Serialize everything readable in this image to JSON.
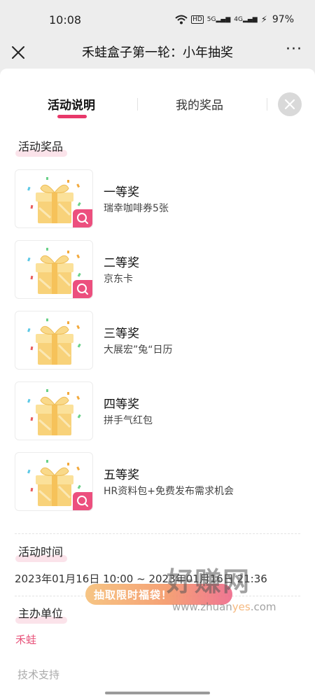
{
  "status_bar": {
    "time": "10:08",
    "hd_badge": "HD",
    "net_5g": "5G",
    "net_4g": "4G",
    "battery": "97%"
  },
  "nav": {
    "title": "禾蛙盒子第一轮：小年抽奖",
    "more": "···"
  },
  "tabs": [
    {
      "label": "活动说明",
      "active": true
    },
    {
      "label": "我的奖品",
      "active": false
    }
  ],
  "sections": {
    "prizes_title": "活动奖品",
    "time_title": "活动时间",
    "organizer_title": "主办单位"
  },
  "prizes": [
    {
      "name": "一等奖",
      "desc": "瑞幸咖啡券5张",
      "has_zoom": true
    },
    {
      "name": "二等奖",
      "desc": "京东卡",
      "has_zoom": true
    },
    {
      "name": "三等奖",
      "desc": "大展宏”兔“日历",
      "has_zoom": false
    },
    {
      "name": "四等奖",
      "desc": "拼手气红包",
      "has_zoom": false
    },
    {
      "name": "五等奖",
      "desc": "HR资料包+免费发布需求机会",
      "has_zoom": true
    }
  ],
  "activity_time": "2023年01月16日 10:00 ~ 2023年01月16日 21:36",
  "organizer": "禾蛙",
  "tech_support": "技术支持",
  "draw_banner": "抽取限时福袋！",
  "watermark": {
    "big": "好赚网",
    "small_prefix": "www.zhuan",
    "small_highlight": "yes",
    "small_suffix": ".com"
  },
  "colors": {
    "accent": "#e8386a",
    "zoom_badge": "#ec4f7e",
    "organizer": "#e8557c",
    "page_bg": "#ededed",
    "panel_bg": "#ffffff"
  },
  "icons": [
    "close-icon",
    "more-icon",
    "wifi-icon",
    "signal-icon",
    "battery-icon",
    "gift-icon",
    "search-icon"
  ]
}
